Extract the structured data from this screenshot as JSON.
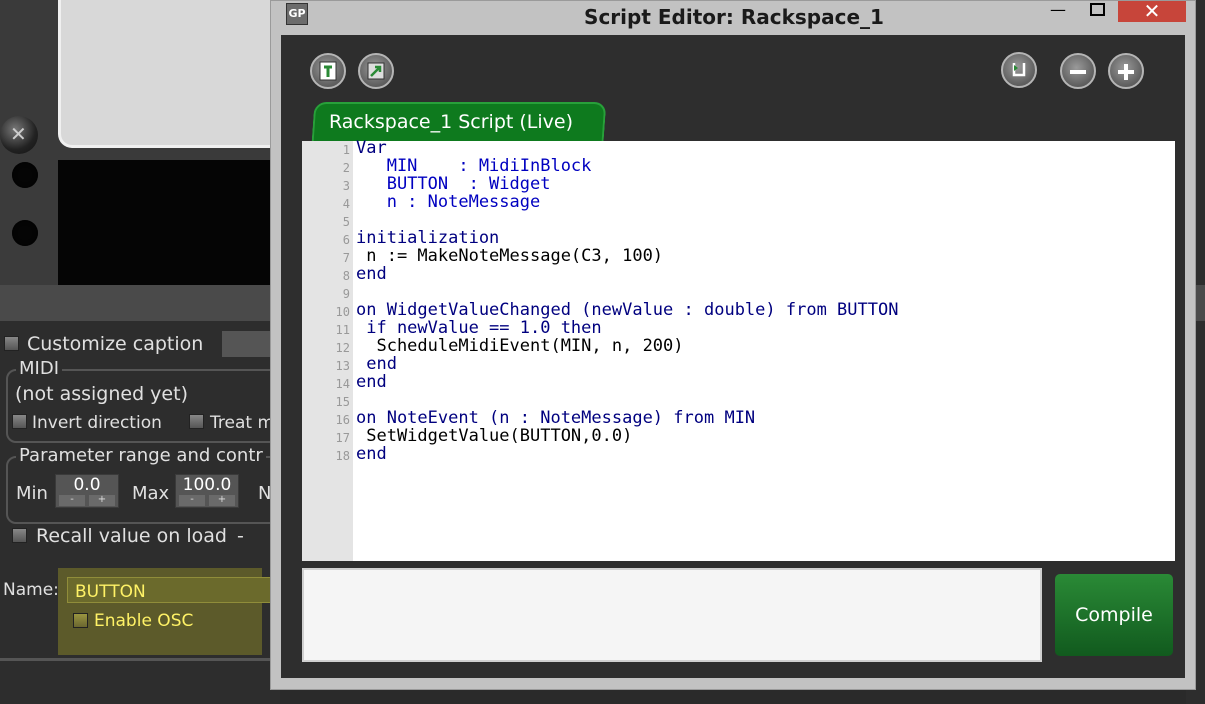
{
  "background_app": {
    "customize_caption": "Customize caption",
    "midi_group": "MIDI",
    "not_assigned": "(not assigned yet)",
    "invert_direction": "Invert direction",
    "treat": "Treat m",
    "param_group": "Parameter range and contr",
    "min_label": "Min",
    "min_value": "0.0",
    "max_label": "Max",
    "max_value": "100.0",
    "n_label": "N",
    "spin_minus": "-",
    "spin_plus": "+",
    "recall_value": "Recall value on load",
    "recall_dash": "-",
    "name_label": "Name:",
    "name_value": "BUTTON",
    "enable_osc": "Enable OSC"
  },
  "window": {
    "title": "Script Editor:  Rackspace_1",
    "app_icon": "GP",
    "minimize": "—",
    "close": "✕"
  },
  "toolbar": {
    "left_icons": [
      "template-icon",
      "export-icon"
    ],
    "right_icons": [
      "return-icon",
      "zoom-out-icon",
      "zoom-in-icon"
    ]
  },
  "tab": {
    "label": "Rackspace_1 Script (Live)"
  },
  "editor": {
    "line_numbers": [
      "1",
      "2",
      "3",
      "4",
      "5",
      "6",
      "7",
      "8",
      "9",
      "10",
      "11",
      "12",
      "13",
      "14",
      "15",
      "16",
      "17",
      "18"
    ],
    "lines": [
      "Var",
      "   MIN    : MidiInBlock",
      "   BUTTON  : Widget",
      "   n : NoteMessage",
      "",
      "initialization",
      " n := MakeNoteMessage(C3, 100)",
      "end",
      "",
      "on WidgetValueChanged (newValue : double) from BUTTON",
      " if newValue == 1.0 then",
      "  ScheduleMidiEvent(MIN, n, 200)",
      " end",
      "end",
      "",
      "on NoteEvent (n : NoteMessage) from MIN",
      " SetWidgetValue(BUTTON,0.0)",
      "end"
    ]
  },
  "output": {
    "text": ""
  },
  "compile_button": {
    "label": "Compile"
  },
  "colors": {
    "tab_green": "#0e7a1e",
    "compile_green": "#1f7a2c",
    "keyword_blue": "#00007f",
    "highlight_yellow": "#ffff33",
    "close_red": "#c7453a"
  }
}
